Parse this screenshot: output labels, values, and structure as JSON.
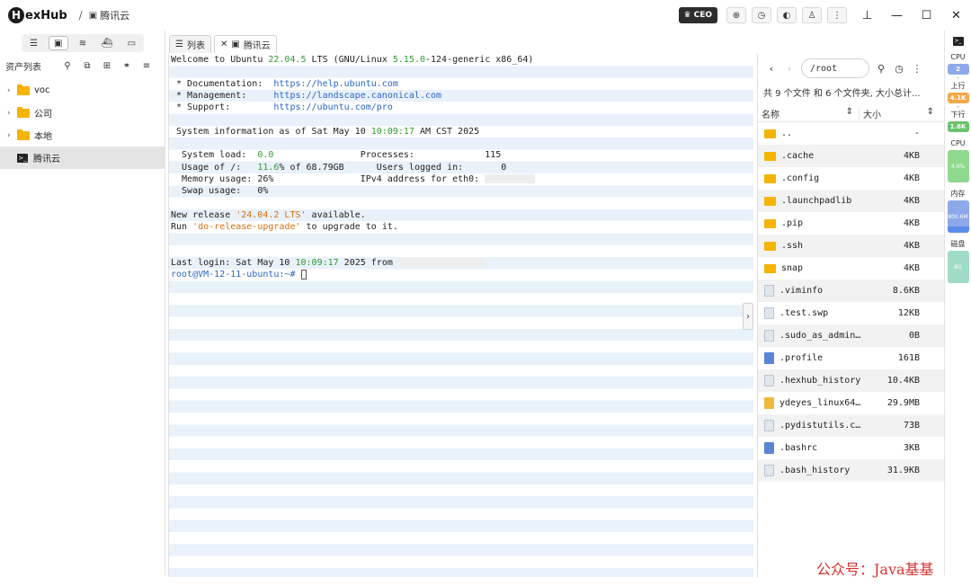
{
  "app": {
    "logo_letter": "H",
    "logo_text": "exHub",
    "separator": "/",
    "session_name": "腾讯云"
  },
  "toolbar": {
    "ceo_label": "CEO"
  },
  "sidebar": {
    "asset_title": "资产列表",
    "tree": [
      {
        "label": "voc",
        "type": "folder"
      },
      {
        "label": "公司",
        "type": "folder"
      },
      {
        "label": "本地",
        "type": "folder"
      },
      {
        "label": "腾讯云",
        "type": "terminal"
      }
    ]
  },
  "tabs": [
    {
      "label": "列表"
    },
    {
      "label": "腾讯云"
    }
  ],
  "terminal": {
    "welcome": {
      "pre": "Welcome to Ubuntu ",
      "ver": "22.04.5",
      "mid": " LTS (GNU/Linux ",
      "kernel": "5.15.0",
      "post": "-124-generic x86_64)"
    },
    "doc_label": " * Documentation:  ",
    "doc_url": "https://help.ubuntu.com",
    "mgmt_label": " * Management:     ",
    "mgmt_url": "https://landscape.canonical.com",
    "support_label": " * Support:        ",
    "support_url": "https://ubuntu.com/pro",
    "sysinfo_pre": " System information as of Sat May 10 ",
    "sysinfo_time": "10:09:17",
    "sysinfo_post": " AM CST 2025",
    "load_label": "  System load:  ",
    "load_val": "0.0",
    "load_pad": "                ",
    "proc_label": "Processes:             ",
    "proc_val": "115",
    "usage_label": "  Usage of /:   ",
    "usage_val": "11.6",
    "usage_rest": "% of 68.79GB      ",
    "users_label": "Users logged in:       ",
    "users_val": "0",
    "mem_line": "  Memory usage: 26%                IPv4 address for eth0: ",
    "swap_line": "  Swap usage:   0%",
    "release_pre": "New release ",
    "release_ver": "'24.04.2 LTS'",
    "release_post": " available.",
    "run_pre": "Run ",
    "run_cmd": "'do-release-upgrade'",
    "run_post": " to upgrade to it.",
    "login_pre": "Last login: Sat May 10 ",
    "login_time": "10:09:17",
    "login_post": " 2025 from ",
    "prompt": "root@VM-12-11-ubuntu:~# "
  },
  "files": {
    "path": "/root",
    "summary": "共 9 个文件 和 6 个文件夹, 大小总计...",
    "col_name": "名称",
    "col_size": "大小",
    "rows": [
      {
        "name": "..",
        "size": "-",
        "icon": "folder"
      },
      {
        "name": ".cache",
        "size": "4KB",
        "icon": "folder"
      },
      {
        "name": ".config",
        "size": "4KB",
        "icon": "folder"
      },
      {
        "name": ".launchpadlib",
        "size": "4KB",
        "icon": "folder"
      },
      {
        "name": ".pip",
        "size": "4KB",
        "icon": "folder"
      },
      {
        "name": ".ssh",
        "size": "4KB",
        "icon": "folder"
      },
      {
        "name": "snap",
        "size": "4KB",
        "icon": "folder"
      },
      {
        "name": ".viminfo",
        "size": "8.6KB",
        "icon": "file"
      },
      {
        "name": ".test.swp",
        "size": "12KB",
        "icon": "file"
      },
      {
        "name": ".sudo_as_admin…",
        "size": "0B",
        "icon": "file"
      },
      {
        "name": ".profile",
        "size": "161B",
        "icon": "blue"
      },
      {
        "name": ".hexhub_history",
        "size": "10.4KB",
        "icon": "file"
      },
      {
        "name": "ydeyes_linux64…",
        "size": "29.9MB",
        "icon": "yellow"
      },
      {
        "name": ".pydistutils.c…",
        "size": "73B",
        "icon": "file"
      },
      {
        "name": ".bashrc",
        "size": "3KB",
        "icon": "blue"
      },
      {
        "name": ".bash_history",
        "size": "31.9KB",
        "icon": "file"
      }
    ]
  },
  "status": {
    "cpu_label": "CPU",
    "cpu_cores": "2",
    "dash1": "-",
    "up_label": "上行",
    "up_val": "4.1K",
    "dash2": "-",
    "down_label": "下行",
    "down_val": "1.6K",
    "cpu2_label": "CPU",
    "cpu_pct": "4.0%",
    "cpu_fraction": 0.35,
    "mem_label": "内存",
    "mem_val": "800.6M",
    "mem_fraction": 0.22,
    "disk_label": "磁盘",
    "disk_val": "8G",
    "disk_fraction": 1.0,
    "colors": {
      "cpu": "#8ea9ea",
      "up": "#f3a94a",
      "down": "#6cc36c",
      "bar_green": "#8fd98f",
      "bar_blue": "#5a8ee8"
    }
  },
  "watermark": "公众号：Java基基"
}
